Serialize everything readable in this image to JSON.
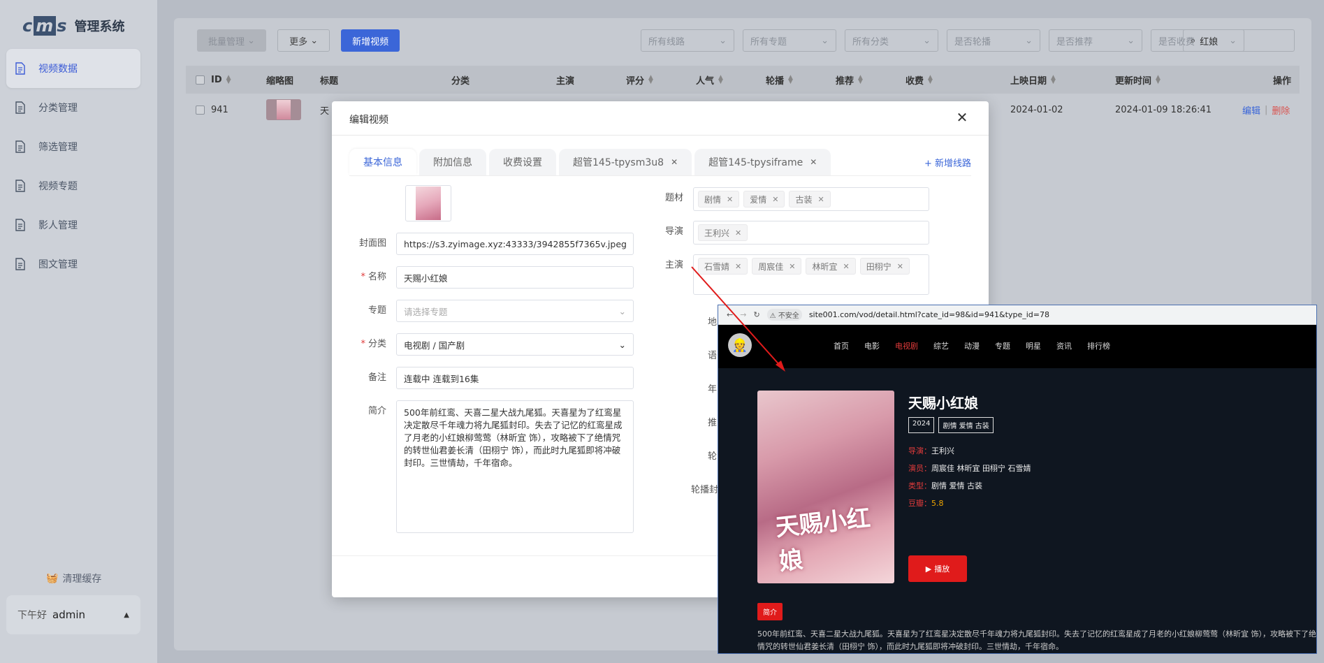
{
  "app": {
    "logo_text": "cms",
    "title": "管理系统"
  },
  "sidebar": {
    "items": [
      {
        "label": "视频数据",
        "active": true
      },
      {
        "label": "分类管理",
        "active": false
      },
      {
        "label": "筛选管理",
        "active": false
      },
      {
        "label": "视频专题",
        "active": false
      },
      {
        "label": "影人管理",
        "active": false
      },
      {
        "label": "图文管理",
        "active": false
      }
    ],
    "clear_cache": "清理缓存",
    "greeting": "下午好",
    "user": "admin"
  },
  "toolbar": {
    "batch": "批量管理",
    "more": "更多",
    "add_video": "新增视频"
  },
  "filters": [
    "所有线路",
    "所有专题",
    "所有分类",
    "是否轮播",
    "是否推荐",
    "是否收费"
  ],
  "search": {
    "value": "红娘"
  },
  "table": {
    "headers": {
      "id": "ID",
      "thumb": "缩略图",
      "title": "标题",
      "category": "分类",
      "actor": "主演",
      "score": "评分",
      "popularity": "人气",
      "carousel": "轮播",
      "recommend": "推荐",
      "charge": "收费",
      "release": "上映日期",
      "updated": "更新时间",
      "actions": "操作"
    },
    "rows": [
      {
        "id": "941",
        "title_partial": "天",
        "release": "2024-01-02",
        "updated": "2024-01-09 18:26:41",
        "edit": "编辑",
        "delete": "删除"
      }
    ]
  },
  "modal": {
    "title": "编辑视频",
    "tabs": [
      {
        "label": "基本信息",
        "active": true,
        "closable": false
      },
      {
        "label": "附加信息",
        "active": false,
        "closable": false
      },
      {
        "label": "收费设置",
        "active": false,
        "closable": false
      },
      {
        "label": "超管145-tpysm3u8",
        "active": false,
        "closable": true
      },
      {
        "label": "超管145-tpysiframe",
        "active": false,
        "closable": true
      }
    ],
    "add_route": "+ 新增线路",
    "form": {
      "cover_label": "封面图",
      "cover_value": "https://s3.zyimage.xyz:43333/3942855f7365v.jpeg",
      "name_label": "名称",
      "name_value": "天赐小红娘",
      "topic_label": "专题",
      "topic_placeholder": "请选择专题",
      "category_label": "分类",
      "category_value": "电视剧 / 国产剧",
      "remark_label": "备注",
      "remark_value": "连载中 连载到16集",
      "intro_label": "简介",
      "intro_value": "500年前红鸾、天喜二星大战九尾狐。天喜星为了红鸾星决定散尽千年魂力将九尾狐封印。失去了记忆的红鸾星成了月老的小红娘柳莺莺（林昕宜 饰），攻略被下了绝情咒的转世仙君姜长清（田栩宁 饰），而此时九尾狐即将冲破封印。三世情劫，千年宿命。",
      "genre_label": "题材",
      "genres": [
        "剧情",
        "爱情",
        "古装"
      ],
      "director_label": "导演",
      "directors": [
        "王利兴"
      ],
      "actor_label": "主演",
      "actors": [
        "石雪婧",
        "周宸佳",
        "林昕宜",
        "田栩宁"
      ],
      "r_labels": [
        "地",
        "语",
        "年",
        "推",
        "轮",
        "轮播封"
      ]
    }
  },
  "browser": {
    "security": "不安全",
    "url": "site001.com/vod/detail.html?cate_id=98&id=941&type_id=78",
    "nav": [
      "首页",
      "电影",
      "电视剧",
      "综艺",
      "动漫",
      "专题",
      "明星",
      "资讯",
      "排行榜"
    ],
    "active_nav": "电视剧",
    "title": "天赐小红娘",
    "poster_text": "天赐小红娘",
    "year": "2024",
    "tags": "剧情 爱情 古装",
    "director_k": "导演：",
    "director_v": "王利兴",
    "actors_k": "演员：",
    "actors_v": "周宸佳 林昕宜 田栩宁 石雪婧",
    "type_k": "类型：",
    "type_v": "剧情 爱情 古装",
    "douban_k": "豆瓣：",
    "douban_v": "5.8",
    "play": "播放",
    "intro_tag": "简介",
    "intro": "500年前红鸾、天喜二星大战九尾狐。天喜星为了红鸾星决定散尽千年魂力将九尾狐封印。失去了记忆的红鸾星成了月老的小红娘柳莺莺（林昕宜 饰），攻略被下了绝情咒的转世仙君姜长清（田栩宁 饰），而此时九尾狐即将冲破封印。三世情劫，千年宿命。"
  },
  "colors": {
    "accent": "#3b66d8",
    "danger": "#d9534f",
    "site_red": "#e01b1b"
  }
}
